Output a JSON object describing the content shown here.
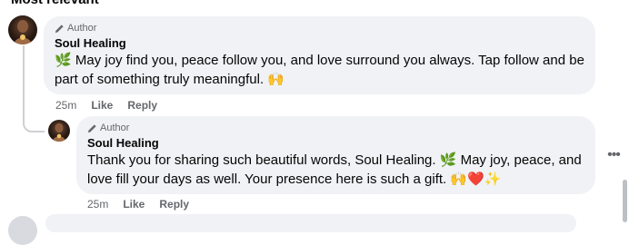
{
  "heading": "Most relevant",
  "comments": [
    {
      "badge": "Author",
      "author": "Soul Healing",
      "emoji_start": "🌿",
      "text": " May joy find you, peace follow you, and love surround you always. Tap follow and be part of something truly meaningful. ",
      "emoji_end": "🙌",
      "time": "25m",
      "like_label": "Like",
      "reply_label": "Reply"
    },
    {
      "badge": "Author",
      "author": "Soul Healing",
      "text_a": "Thank you for sharing such beautiful words, Soul Healing. ",
      "emoji_mid": "🌿",
      "text_b": " May joy, peace, and love fill your days as well. Your presence here is such a gift. ",
      "emoji_end": "🙌❤️✨",
      "time": "25m",
      "like_label": "Like",
      "reply_label": "Reply"
    }
  ],
  "more_icon": "ellipsis-icon",
  "colors": {
    "bubble_bg": "#f0f2f5",
    "meta_text": "#65676b",
    "thread_line": "#ced0d4"
  }
}
